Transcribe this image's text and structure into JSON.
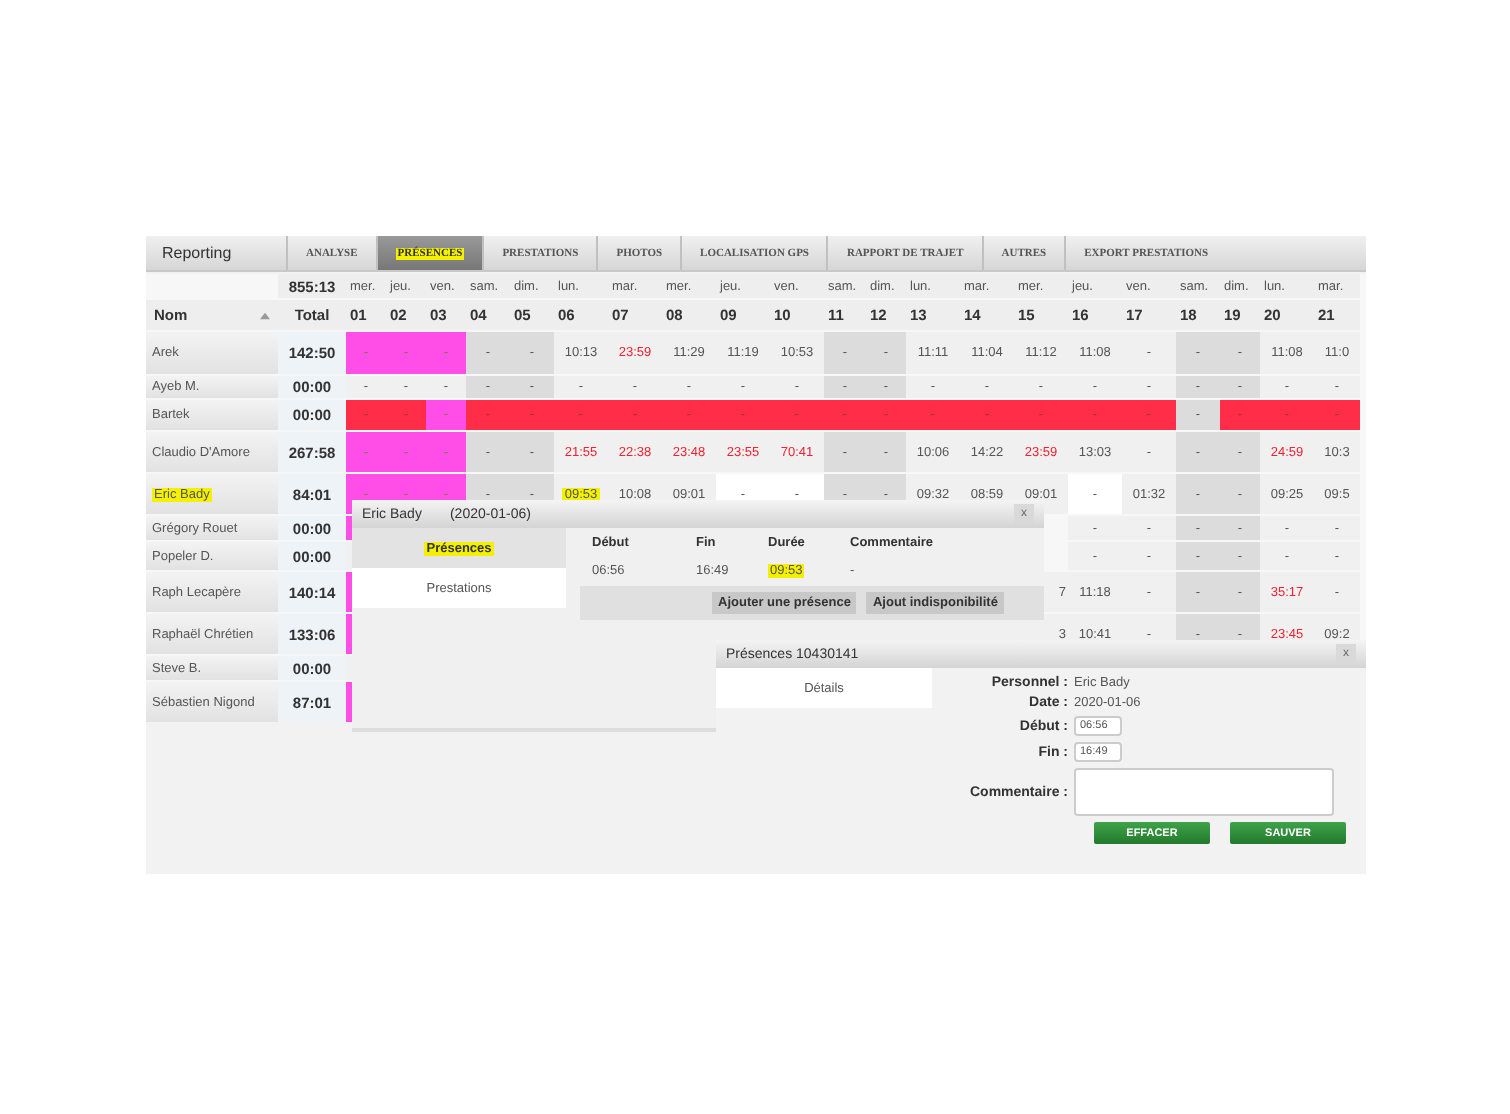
{
  "tabs_bar": {
    "title": "Reporting",
    "tabs": [
      {
        "label": "ANALYSE",
        "selected": false
      },
      {
        "label": "PRÉSENCES",
        "selected": true
      },
      {
        "label": "PRESTATIONS",
        "selected": false
      },
      {
        "label": "PHOTOS",
        "selected": false
      },
      {
        "label": "LOCALISATION GPS",
        "selected": false
      },
      {
        "label": "RAPPORT DE TRAJET",
        "selected": false
      },
      {
        "label": "AUTRES",
        "selected": false
      },
      {
        "label": "EXPORT PRESTATIONS",
        "selected": false
      }
    ]
  },
  "grid": {
    "grand_total": "855:13",
    "name_header": "Nom",
    "total_header": "Total",
    "days": [
      {
        "weekday": "mer.",
        "day": "01"
      },
      {
        "weekday": "jeu.",
        "day": "02"
      },
      {
        "weekday": "ven.",
        "day": "03"
      },
      {
        "weekday": "sam.",
        "day": "04"
      },
      {
        "weekday": "dim.",
        "day": "05"
      },
      {
        "weekday": "lun.",
        "day": "06"
      },
      {
        "weekday": "mar.",
        "day": "07"
      },
      {
        "weekday": "mer.",
        "day": "08"
      },
      {
        "weekday": "jeu.",
        "day": "09"
      },
      {
        "weekday": "ven.",
        "day": "10"
      },
      {
        "weekday": "sam.",
        "day": "11"
      },
      {
        "weekday": "dim.",
        "day": "12"
      },
      {
        "weekday": "lun.",
        "day": "13"
      },
      {
        "weekday": "mar.",
        "day": "14"
      },
      {
        "weekday": "mer.",
        "day": "15"
      },
      {
        "weekday": "jeu.",
        "day": "16"
      },
      {
        "weekday": "ven.",
        "day": "17"
      },
      {
        "weekday": "sam.",
        "day": "18"
      },
      {
        "weekday": "dim.",
        "day": "19"
      },
      {
        "weekday": "lun.",
        "day": "20"
      },
      {
        "weekday": "mar.",
        "day": "21"
      }
    ],
    "rows": [
      {
        "name": "Arek",
        "marked": false,
        "total": "142:50",
        "cells": [
          {
            "kind": "pink",
            "text": "-"
          },
          {
            "kind": "pink",
            "text": "-"
          },
          {
            "kind": "pink",
            "text": "-"
          },
          {
            "kind": "weekend",
            "text": "-"
          },
          {
            "kind": "weekend",
            "text": "-"
          },
          {
            "kind": "plain",
            "text": "10:13"
          },
          {
            "kind": "alert",
            "text": "23:59"
          },
          {
            "kind": "plain",
            "text": "11:29"
          },
          {
            "kind": "plain",
            "text": "11:19"
          },
          {
            "kind": "plain",
            "text": "10:53"
          },
          {
            "kind": "weekend",
            "text": "-"
          },
          {
            "kind": "weekend",
            "text": "-"
          },
          {
            "kind": "plain",
            "text": "11:11"
          },
          {
            "kind": "plain",
            "text": "11:04"
          },
          {
            "kind": "plain",
            "text": "11:12"
          },
          {
            "kind": "plain",
            "text": "11:08"
          },
          {
            "kind": "plain",
            "text": "-"
          },
          {
            "kind": "weekend",
            "text": "-"
          },
          {
            "kind": "weekend",
            "text": "-"
          },
          {
            "kind": "plain",
            "text": "11:08"
          },
          {
            "kind": "plain",
            "text": "11:0"
          }
        ]
      },
      {
        "name": "Ayeb M.",
        "marked": false,
        "total": "00:00",
        "cells": [
          {
            "kind": "plain",
            "text": "-"
          },
          {
            "kind": "plain",
            "text": "-"
          },
          {
            "kind": "plain",
            "text": "-"
          },
          {
            "kind": "weekend",
            "text": "-"
          },
          {
            "kind": "weekend",
            "text": "-"
          },
          {
            "kind": "plain",
            "text": "-"
          },
          {
            "kind": "plain",
            "text": "-"
          },
          {
            "kind": "plain",
            "text": "-"
          },
          {
            "kind": "plain",
            "text": "-"
          },
          {
            "kind": "plain",
            "text": "-"
          },
          {
            "kind": "weekend",
            "text": "-"
          },
          {
            "kind": "weekend",
            "text": "-"
          },
          {
            "kind": "plain",
            "text": "-"
          },
          {
            "kind": "plain",
            "text": "-"
          },
          {
            "kind": "plain",
            "text": "-"
          },
          {
            "kind": "plain",
            "text": "-"
          },
          {
            "kind": "plain",
            "text": "-"
          },
          {
            "kind": "weekend",
            "text": "-"
          },
          {
            "kind": "weekend",
            "text": "-"
          },
          {
            "kind": "plain",
            "text": "-"
          },
          {
            "kind": "plain",
            "text": "-"
          }
        ]
      },
      {
        "name": "Bartek",
        "marked": false,
        "total": "00:00",
        "cells": [
          {
            "kind": "red",
            "text": "-"
          },
          {
            "kind": "red",
            "text": "-"
          },
          {
            "kind": "pink",
            "text": "-"
          },
          {
            "kind": "red",
            "text": "-"
          },
          {
            "kind": "red",
            "text": "-"
          },
          {
            "kind": "red",
            "text": "-"
          },
          {
            "kind": "red",
            "text": "-"
          },
          {
            "kind": "red",
            "text": "-"
          },
          {
            "kind": "red",
            "text": "-"
          },
          {
            "kind": "red",
            "text": "-"
          },
          {
            "kind": "red",
            "text": "-"
          },
          {
            "kind": "red",
            "text": "-"
          },
          {
            "kind": "red",
            "text": "-"
          },
          {
            "kind": "red",
            "text": "-"
          },
          {
            "kind": "red",
            "text": "-"
          },
          {
            "kind": "red",
            "text": "-"
          },
          {
            "kind": "red",
            "text": "-"
          },
          {
            "kind": "weekend",
            "text": "-"
          },
          {
            "kind": "red",
            "text": "-"
          },
          {
            "kind": "red",
            "text": "-"
          },
          {
            "kind": "red",
            "text": "-"
          }
        ]
      },
      {
        "name": "Claudio D'Amore",
        "marked": false,
        "total": "267:58",
        "cells": [
          {
            "kind": "pink",
            "text": "-"
          },
          {
            "kind": "pink",
            "text": "-"
          },
          {
            "kind": "pink",
            "text": "-"
          },
          {
            "kind": "weekend",
            "text": "-"
          },
          {
            "kind": "weekend",
            "text": "-"
          },
          {
            "kind": "alert",
            "text": "21:55"
          },
          {
            "kind": "alert",
            "text": "22:38"
          },
          {
            "kind": "alert",
            "text": "23:48"
          },
          {
            "kind": "alert",
            "text": "23:55"
          },
          {
            "kind": "alert",
            "text": "70:41"
          },
          {
            "kind": "weekend",
            "text": "-"
          },
          {
            "kind": "weekend",
            "text": "-"
          },
          {
            "kind": "plain",
            "text": "10:06"
          },
          {
            "kind": "plain",
            "text": "14:22"
          },
          {
            "kind": "alert",
            "text": "23:59"
          },
          {
            "kind": "plain",
            "text": "13:03"
          },
          {
            "kind": "plain",
            "text": "-"
          },
          {
            "kind": "weekend",
            "text": "-"
          },
          {
            "kind": "weekend",
            "text": "-"
          },
          {
            "kind": "alert",
            "text": "24:59"
          },
          {
            "kind": "plain",
            "text": "10:3"
          }
        ]
      },
      {
        "name": "Eric Bady",
        "marked": true,
        "total": "84:01",
        "cells": [
          {
            "kind": "pink",
            "text": "-"
          },
          {
            "kind": "pink",
            "text": "-"
          },
          {
            "kind": "pink",
            "text": "-"
          },
          {
            "kind": "weekend",
            "text": "-"
          },
          {
            "kind": "weekend",
            "text": "-"
          },
          {
            "kind": "mark",
            "text": "09:53"
          },
          {
            "kind": "plain",
            "text": "10:08"
          },
          {
            "kind": "plain",
            "text": "09:01"
          },
          {
            "kind": "white",
            "text": "-"
          },
          {
            "kind": "white",
            "text": "-"
          },
          {
            "kind": "weekend",
            "text": "-"
          },
          {
            "kind": "weekend",
            "text": "-"
          },
          {
            "kind": "plain",
            "text": "09:32"
          },
          {
            "kind": "plain",
            "text": "08:59"
          },
          {
            "kind": "plain",
            "text": "09:01"
          },
          {
            "kind": "white",
            "text": "-"
          },
          {
            "kind": "plain",
            "text": "01:32"
          },
          {
            "kind": "weekend",
            "text": "-"
          },
          {
            "kind": "weekend",
            "text": "-"
          },
          {
            "kind": "plain",
            "text": "09:25"
          },
          {
            "kind": "plain",
            "text": "09:5"
          }
        ]
      },
      {
        "name": "Grégory Rouet",
        "marked": false,
        "total": "00:00",
        "cells": [
          {
            "kind": "pink"
          },
          null,
          null,
          null,
          null,
          null,
          null,
          null,
          null,
          null,
          null,
          null,
          null,
          null,
          null,
          {
            "kind": "plain",
            "text": "-"
          },
          {
            "kind": "plain",
            "text": "-"
          },
          {
            "kind": "weekend",
            "text": "-"
          },
          {
            "kind": "weekend",
            "text": "-"
          },
          {
            "kind": "plain",
            "text": "-"
          },
          {
            "kind": "plain",
            "text": "-"
          }
        ]
      },
      {
        "name": "Popeler D.",
        "marked": false,
        "total": "00:00",
        "cells": [
          {
            "kind": "plain"
          },
          null,
          null,
          null,
          null,
          null,
          null,
          null,
          null,
          null,
          null,
          null,
          null,
          null,
          null,
          {
            "kind": "plain",
            "text": "-"
          },
          {
            "kind": "plain",
            "text": "-"
          },
          {
            "kind": "weekend",
            "text": "-"
          },
          {
            "kind": "weekend",
            "text": "-"
          },
          {
            "kind": "plain",
            "text": "-"
          },
          {
            "kind": "plain",
            "text": "-"
          }
        ]
      },
      {
        "name": "Raph Lecapère",
        "marked": false,
        "total": "140:14",
        "cells": [
          {
            "kind": "pink"
          },
          null,
          null,
          null,
          null,
          null,
          null,
          null,
          null,
          null,
          null,
          null,
          null,
          null,
          {
            "kind": "cut",
            "text": "7"
          },
          {
            "kind": "plain",
            "text": "11:18"
          },
          {
            "kind": "plain",
            "text": "-"
          },
          {
            "kind": "weekend",
            "text": "-"
          },
          {
            "kind": "weekend",
            "text": "-"
          },
          {
            "kind": "alert",
            "text": "35:17"
          },
          {
            "kind": "plain",
            "text": "-"
          }
        ]
      },
      {
        "name": "Raphaël Chrétien",
        "marked": false,
        "total": "133:06",
        "cells": [
          {
            "kind": "pink"
          },
          null,
          null,
          null,
          null,
          null,
          null,
          null,
          null,
          null,
          null,
          null,
          null,
          null,
          {
            "kind": "cut",
            "text": "3"
          },
          {
            "kind": "plain",
            "text": "10:41"
          },
          {
            "kind": "plain",
            "text": "-"
          },
          {
            "kind": "weekend",
            "text": "-"
          },
          {
            "kind": "weekend",
            "text": "-"
          },
          {
            "kind": "alert",
            "text": "23:45"
          },
          {
            "kind": "plain",
            "text": "09:2"
          }
        ]
      },
      {
        "name": "Steve B.",
        "marked": false,
        "total": "00:00",
        "cells": [
          {
            "kind": "plain"
          },
          null,
          null,
          null,
          null,
          null,
          null,
          null,
          null,
          null,
          null,
          null,
          null,
          null,
          null,
          null,
          null,
          null,
          null,
          null,
          null
        ]
      },
      {
        "name": "Sébastien Nigond",
        "marked": false,
        "total": "87:01",
        "cells": [
          {
            "kind": "pink"
          },
          null,
          null,
          null,
          null,
          null,
          null,
          null,
          null,
          null,
          null,
          null,
          null,
          null,
          null,
          null,
          null,
          null,
          null,
          null,
          null
        ]
      }
    ]
  },
  "dialog_day": {
    "title": "Eric Bady",
    "date": "(2020-01-06)",
    "close": "x",
    "tabs": [
      {
        "label": "Présences",
        "selected": true
      },
      {
        "label": "Prestations",
        "selected": false
      }
    ],
    "columns": [
      "Début",
      "Fin",
      "Durée",
      "Commentaire"
    ],
    "row": [
      {
        "text": "06:56",
        "marked": false
      },
      {
        "text": "16:49",
        "marked": false
      },
      {
        "text": "09:53",
        "marked": true
      },
      {
        "text": "-",
        "marked": false
      }
    ],
    "buttons": [
      "Ajouter une présence",
      "Ajout indisponibilité"
    ]
  },
  "dialog_detail": {
    "title": "Présences 10430141",
    "close": "x",
    "tabs": [
      {
        "label": "Détails"
      }
    ],
    "fields": [
      {
        "label": "Personnel :",
        "kind": "text",
        "value": "Eric Bady"
      },
      {
        "label": "Date :",
        "kind": "text",
        "value": "2020-01-06"
      },
      {
        "label": "Début :",
        "kind": "input",
        "value": "06:56"
      },
      {
        "label": "Fin :",
        "kind": "input",
        "value": "16:49"
      },
      {
        "label": "Commentaire :",
        "kind": "textarea"
      }
    ],
    "buttons": [
      "EFFACER",
      "SAUVER"
    ]
  }
}
